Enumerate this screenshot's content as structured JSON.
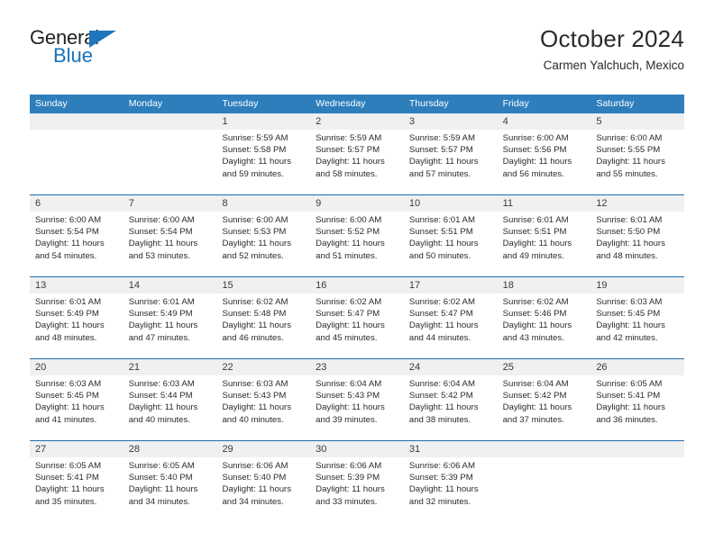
{
  "logo": {
    "text_top": "General",
    "text_bottom": "Blue",
    "triangle_icon": "blue-triangle-icon",
    "colors": {
      "general": "#231f20",
      "blue": "#1573be",
      "triangle": "#1f76bd"
    }
  },
  "header": {
    "title": "October 2024",
    "subtitle": "Carmen Yalchuch, Mexico"
  },
  "theme": {
    "header_bg": "#2e7ebc",
    "header_text": "#ffffff",
    "week_divider": "#1f6fb0",
    "date_band_bg": "#f0f0f0",
    "cell_bg": "#ffffff",
    "body_text": "#2b2b2b"
  },
  "calendar": {
    "weekdays": [
      "Sunday",
      "Monday",
      "Tuesday",
      "Wednesday",
      "Thursday",
      "Friday",
      "Saturday"
    ],
    "weeks": [
      {
        "numbers": [
          "",
          "",
          "1",
          "2",
          "3",
          "4",
          "5"
        ],
        "days": [
          {
            "empty": true,
            "lines": []
          },
          {
            "empty": true,
            "lines": []
          },
          {
            "empty": false,
            "lines": [
              "Sunrise: 5:59 AM",
              "Sunset: 5:58 PM",
              "Daylight: 11 hours",
              "and 59 minutes."
            ]
          },
          {
            "empty": false,
            "lines": [
              "Sunrise: 5:59 AM",
              "Sunset: 5:57 PM",
              "Daylight: 11 hours",
              "and 58 minutes."
            ]
          },
          {
            "empty": false,
            "lines": [
              "Sunrise: 5:59 AM",
              "Sunset: 5:57 PM",
              "Daylight: 11 hours",
              "and 57 minutes."
            ]
          },
          {
            "empty": false,
            "lines": [
              "Sunrise: 6:00 AM",
              "Sunset: 5:56 PM",
              "Daylight: 11 hours",
              "and 56 minutes."
            ]
          },
          {
            "empty": false,
            "lines": [
              "Sunrise: 6:00 AM",
              "Sunset: 5:55 PM",
              "Daylight: 11 hours",
              "and 55 minutes."
            ]
          }
        ]
      },
      {
        "numbers": [
          "6",
          "7",
          "8",
          "9",
          "10",
          "11",
          "12"
        ],
        "days": [
          {
            "empty": false,
            "lines": [
              "Sunrise: 6:00 AM",
              "Sunset: 5:54 PM",
              "Daylight: 11 hours",
              "and 54 minutes."
            ]
          },
          {
            "empty": false,
            "lines": [
              "Sunrise: 6:00 AM",
              "Sunset: 5:54 PM",
              "Daylight: 11 hours",
              "and 53 minutes."
            ]
          },
          {
            "empty": false,
            "lines": [
              "Sunrise: 6:00 AM",
              "Sunset: 5:53 PM",
              "Daylight: 11 hours",
              "and 52 minutes."
            ]
          },
          {
            "empty": false,
            "lines": [
              "Sunrise: 6:00 AM",
              "Sunset: 5:52 PM",
              "Daylight: 11 hours",
              "and 51 minutes."
            ]
          },
          {
            "empty": false,
            "lines": [
              "Sunrise: 6:01 AM",
              "Sunset: 5:51 PM",
              "Daylight: 11 hours",
              "and 50 minutes."
            ]
          },
          {
            "empty": false,
            "lines": [
              "Sunrise: 6:01 AM",
              "Sunset: 5:51 PM",
              "Daylight: 11 hours",
              "and 49 minutes."
            ]
          },
          {
            "empty": false,
            "lines": [
              "Sunrise: 6:01 AM",
              "Sunset: 5:50 PM",
              "Daylight: 11 hours",
              "and 48 minutes."
            ]
          }
        ]
      },
      {
        "numbers": [
          "13",
          "14",
          "15",
          "16",
          "17",
          "18",
          "19"
        ],
        "days": [
          {
            "empty": false,
            "lines": [
              "Sunrise: 6:01 AM",
              "Sunset: 5:49 PM",
              "Daylight: 11 hours",
              "and 48 minutes."
            ]
          },
          {
            "empty": false,
            "lines": [
              "Sunrise: 6:01 AM",
              "Sunset: 5:49 PM",
              "Daylight: 11 hours",
              "and 47 minutes."
            ]
          },
          {
            "empty": false,
            "lines": [
              "Sunrise: 6:02 AM",
              "Sunset: 5:48 PM",
              "Daylight: 11 hours",
              "and 46 minutes."
            ]
          },
          {
            "empty": false,
            "lines": [
              "Sunrise: 6:02 AM",
              "Sunset: 5:47 PM",
              "Daylight: 11 hours",
              "and 45 minutes."
            ]
          },
          {
            "empty": false,
            "lines": [
              "Sunrise: 6:02 AM",
              "Sunset: 5:47 PM",
              "Daylight: 11 hours",
              "and 44 minutes."
            ]
          },
          {
            "empty": false,
            "lines": [
              "Sunrise: 6:02 AM",
              "Sunset: 5:46 PM",
              "Daylight: 11 hours",
              "and 43 minutes."
            ]
          },
          {
            "empty": false,
            "lines": [
              "Sunrise: 6:03 AM",
              "Sunset: 5:45 PM",
              "Daylight: 11 hours",
              "and 42 minutes."
            ]
          }
        ]
      },
      {
        "numbers": [
          "20",
          "21",
          "22",
          "23",
          "24",
          "25",
          "26"
        ],
        "days": [
          {
            "empty": false,
            "lines": [
              "Sunrise: 6:03 AM",
              "Sunset: 5:45 PM",
              "Daylight: 11 hours",
              "and 41 minutes."
            ]
          },
          {
            "empty": false,
            "lines": [
              "Sunrise: 6:03 AM",
              "Sunset: 5:44 PM",
              "Daylight: 11 hours",
              "and 40 minutes."
            ]
          },
          {
            "empty": false,
            "lines": [
              "Sunrise: 6:03 AM",
              "Sunset: 5:43 PM",
              "Daylight: 11 hours",
              "and 40 minutes."
            ]
          },
          {
            "empty": false,
            "lines": [
              "Sunrise: 6:04 AM",
              "Sunset: 5:43 PM",
              "Daylight: 11 hours",
              "and 39 minutes."
            ]
          },
          {
            "empty": false,
            "lines": [
              "Sunrise: 6:04 AM",
              "Sunset: 5:42 PM",
              "Daylight: 11 hours",
              "and 38 minutes."
            ]
          },
          {
            "empty": false,
            "lines": [
              "Sunrise: 6:04 AM",
              "Sunset: 5:42 PM",
              "Daylight: 11 hours",
              "and 37 minutes."
            ]
          },
          {
            "empty": false,
            "lines": [
              "Sunrise: 6:05 AM",
              "Sunset: 5:41 PM",
              "Daylight: 11 hours",
              "and 36 minutes."
            ]
          }
        ]
      },
      {
        "numbers": [
          "27",
          "28",
          "29",
          "30",
          "31",
          "",
          ""
        ],
        "days": [
          {
            "empty": false,
            "lines": [
              "Sunrise: 6:05 AM",
              "Sunset: 5:41 PM",
              "Daylight: 11 hours",
              "and 35 minutes."
            ]
          },
          {
            "empty": false,
            "lines": [
              "Sunrise: 6:05 AM",
              "Sunset: 5:40 PM",
              "Daylight: 11 hours",
              "and 34 minutes."
            ]
          },
          {
            "empty": false,
            "lines": [
              "Sunrise: 6:06 AM",
              "Sunset: 5:40 PM",
              "Daylight: 11 hours",
              "and 34 minutes."
            ]
          },
          {
            "empty": false,
            "lines": [
              "Sunrise: 6:06 AM",
              "Sunset: 5:39 PM",
              "Daylight: 11 hours",
              "and 33 minutes."
            ]
          },
          {
            "empty": false,
            "lines": [
              "Sunrise: 6:06 AM",
              "Sunset: 5:39 PM",
              "Daylight: 11 hours",
              "and 32 minutes."
            ]
          },
          {
            "empty": true,
            "lines": []
          },
          {
            "empty": true,
            "lines": []
          }
        ]
      }
    ]
  }
}
